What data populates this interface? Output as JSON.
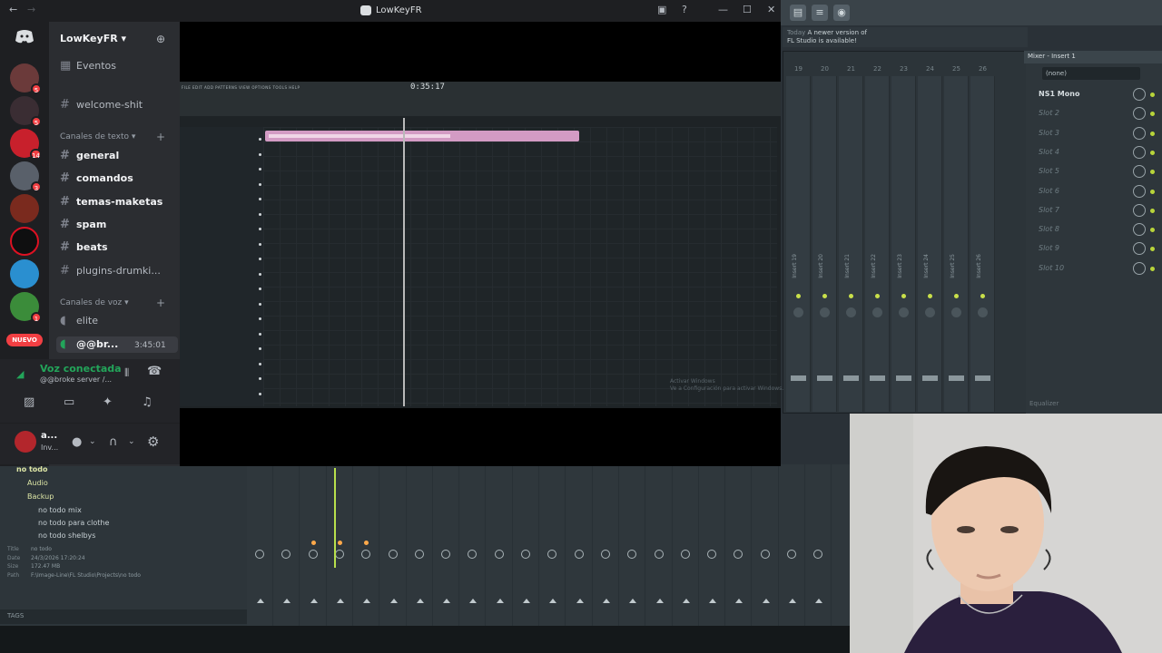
{
  "window": {
    "title": "LowKeyFR"
  },
  "server": {
    "name": "LowKeyFR"
  },
  "channels": {
    "events_label": "Eventos",
    "welcome": "welcome-shit",
    "text_category": "Canales de texto",
    "text": [
      "general",
      "comandos",
      "temas-maketas",
      "spam",
      "beats",
      "plugins-drumki..."
    ],
    "voice_category": "Canales de voz",
    "voice": [
      {
        "name": "elite"
      },
      {
        "name": "@@br...",
        "time": "3:45:01"
      }
    ]
  },
  "guild_badges": [
    "5",
    "5",
    "14",
    "3",
    "1"
  ],
  "nuevo_label": "NUEVO",
  "voice_status": {
    "title": "Voz conectada",
    "subtitle": "@@broke server /..."
  },
  "user": {
    "name": "a...",
    "status": "Inv..."
  },
  "fl": {
    "hint_line1": "A newer version of",
    "hint_line2": "FL Studio is available!",
    "hint_today": "Today",
    "mixer_title": "Mixer - Insert 1",
    "insert_none": "(none)",
    "slots": [
      "NS1 Mono",
      "Slot 2",
      "Slot 3",
      "Slot 4",
      "Slot 5",
      "Slot 6",
      "Slot 7",
      "Slot 8",
      "Slot 9",
      "Slot 10"
    ],
    "eq_label": "Equalizer",
    "track_numbers": [
      "19",
      "20",
      "21",
      "22",
      "23",
      "24",
      "25",
      "26"
    ],
    "track_names": [
      "Insert 19",
      "Insert 20",
      "Insert 21",
      "Insert 22",
      "Insert 23",
      "Insert 24",
      "Insert 25",
      "Insert 26"
    ],
    "browser": {
      "root": "no todo",
      "folders": [
        "Audio",
        "Backup"
      ],
      "files": [
        "no todo mix",
        "no todo para clothe",
        "no todo shelbys"
      ],
      "info": [
        {
          "k": "Title",
          "v": "no todo"
        },
        {
          "k": "Date",
          "v": "24/3/2026 17:20:24"
        },
        {
          "k": "Size",
          "v": "172.47 MB"
        },
        {
          "k": "Path",
          "v": "F:\\Image-Line\\FL Studio\\Projects\\no todo"
        }
      ],
      "tags": "TAGS"
    },
    "playlist_time": "0:35:17",
    "playlist_menu": "FILE EDIT ADD PATTERNS VIEW OPTIONS TOOLS HELP",
    "activate_line1": "Activar Windows",
    "activate_line2": "Ve a Configuración para activar Windows."
  },
  "colors": {
    "discord_bg": "#2b2d31",
    "accent_green": "#23a55a",
    "badge_red": "#f23f43",
    "clip_pink": "#d39bc4"
  }
}
